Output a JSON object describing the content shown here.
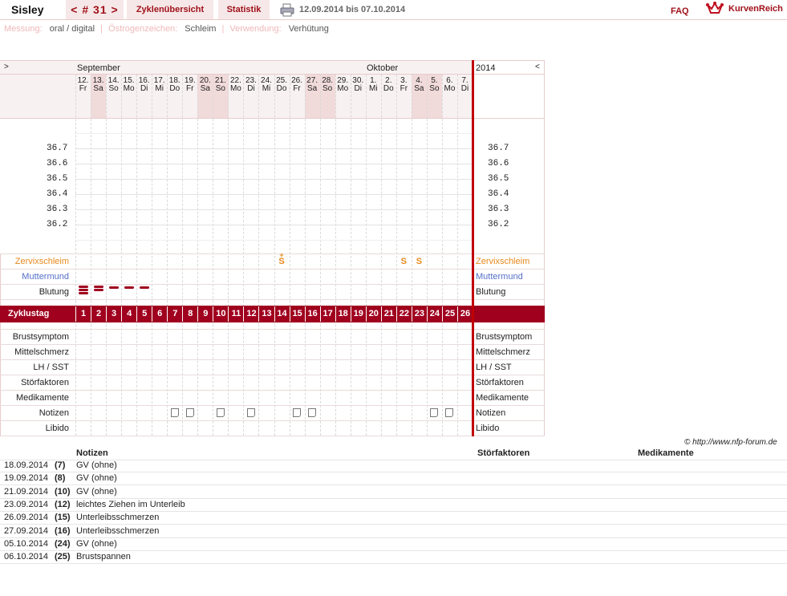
{
  "header": {
    "user": "Sisley",
    "cycle_nav": "< # 31 >",
    "tab_overview": "Zyklenübersicht",
    "tab_stats": "Statistik",
    "date_range": "12.09.2014 bis 07.10.2014",
    "faq": "FAQ",
    "logo": "KurvenReich"
  },
  "settings": {
    "measure_label": "Messung:",
    "measure_value": "oral / digital",
    "sign_label": "Östrogenzeichen:",
    "sign_value": "Schleim",
    "use_label": "Verwendung:",
    "use_value": "Verhütung"
  },
  "chart_data": {
    "type": "table",
    "nav_left": ">",
    "nav_right": "<",
    "months": [
      "September",
      "Oktober"
    ],
    "year": "2014",
    "days": [
      {
        "d": "12.",
        "w": "Fr"
      },
      {
        "d": "13.",
        "w": "Sa"
      },
      {
        "d": "14.",
        "w": "So"
      },
      {
        "d": "15.",
        "w": "Mo"
      },
      {
        "d": "16.",
        "w": "Di"
      },
      {
        "d": "17.",
        "w": "Mi"
      },
      {
        "d": "18.",
        "w": "Do"
      },
      {
        "d": "19.",
        "w": "Fr"
      },
      {
        "d": "20.",
        "w": "Sa"
      },
      {
        "d": "21.",
        "w": "So"
      },
      {
        "d": "22.",
        "w": "Mo"
      },
      {
        "d": "23.",
        "w": "Di"
      },
      {
        "d": "24.",
        "w": "Mi"
      },
      {
        "d": "25.",
        "w": "Do"
      },
      {
        "d": "26.",
        "w": "Fr"
      },
      {
        "d": "27.",
        "w": "Sa"
      },
      {
        "d": "28.",
        "w": "So"
      },
      {
        "d": "29.",
        "w": "Mo"
      },
      {
        "d": "30.",
        "w": "Di"
      },
      {
        "d": "1.",
        "w": "Mi"
      },
      {
        "d": "2.",
        "w": "Do"
      },
      {
        "d": "3.",
        "w": "Fr"
      },
      {
        "d": "4.",
        "w": "Sa"
      },
      {
        "d": "5.",
        "w": "So"
      },
      {
        "d": "6.",
        "w": "Mo"
      },
      {
        "d": "7.",
        "w": "Di"
      }
    ],
    "temp_ticks": [
      "36.7",
      "36.6",
      "36.5",
      "36.4",
      "36.3",
      "36.2"
    ],
    "cycle_days": [
      "1",
      "2",
      "3",
      "4",
      "5",
      "6",
      "7",
      "8",
      "9",
      "10",
      "11",
      "12",
      "13",
      "14",
      "15",
      "16",
      "17",
      "18",
      "19",
      "20",
      "21",
      "22",
      "23",
      "24",
      "25",
      "26"
    ],
    "cycle_label": "Zyklustag",
    "rows_top": {
      "mucus": "Zervixschleim",
      "cervix": "Muttermund",
      "bleeding": "Blutung"
    },
    "rows_bottom": [
      "Brustsymptom",
      "Mittelschmerz",
      "LH / SST",
      "Störfaktoren",
      "Medikamente",
      "Notizen",
      "Libido"
    ],
    "mucus_marks": [
      {
        "day": 14,
        "symbol": "S",
        "plus": "+"
      },
      {
        "day": 22,
        "symbol": "S",
        "plus": ""
      },
      {
        "day": 23,
        "symbol": "S",
        "plus": ""
      }
    ],
    "bleeding": [
      {
        "day": 1,
        "level": "heavy"
      },
      {
        "day": 2,
        "level": "medium"
      },
      {
        "day": 3,
        "level": "light"
      },
      {
        "day": 4,
        "level": "light"
      },
      {
        "day": 5,
        "level": "light"
      }
    ],
    "note_days": [
      7,
      8,
      10,
      12,
      15,
      16,
      24,
      25
    ],
    "colors": {
      "accent": "#a0001e",
      "mucus": "#e8891c",
      "cervix": "#5570c8",
      "red_line": "#c00000"
    }
  },
  "credit": "© http://www.nfp-forum.de",
  "notes": {
    "headers": {
      "notes": "Notizen",
      "factors": "Störfaktoren",
      "meds": "Medikamente"
    },
    "rows": [
      {
        "date": "18.09.2014",
        "day": "(7)",
        "note": "GV (ohne)"
      },
      {
        "date": "19.09.2014",
        "day": "(8)",
        "note": "GV (ohne)"
      },
      {
        "date": "21.09.2014",
        "day": "(10)",
        "note": "GV (ohne)"
      },
      {
        "date": "23.09.2014",
        "day": "(12)",
        "note": "leichtes Ziehen im Unterleib"
      },
      {
        "date": "26.09.2014",
        "day": "(15)",
        "note": "Unterleibsschmerzen"
      },
      {
        "date": "27.09.2014",
        "day": "(16)",
        "note": "Unterleibsschmerzen"
      },
      {
        "date": "05.10.2014",
        "day": "(24)",
        "note": "GV (ohne)"
      },
      {
        "date": "06.10.2014",
        "day": "(25)",
        "note": "Brustspannen"
      }
    ]
  }
}
